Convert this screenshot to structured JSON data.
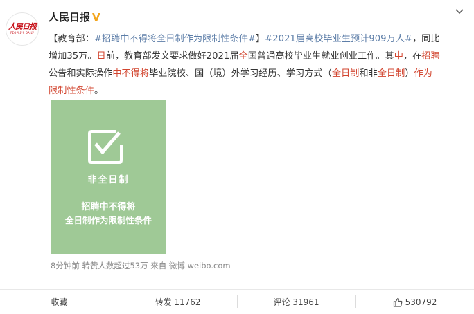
{
  "author": {
    "name": "人民日报",
    "avatar_cn": "人民日报",
    "avatar_en": "PEOPLE'S DAILY",
    "verified_mark": "V",
    "more_icon": "chevron-down-icon"
  },
  "post": {
    "lines": [
      [
        {
          "t": "【教育部：",
          "c": "normal"
        },
        {
          "t": "#招聘中不得将全日制作为限制性条件#",
          "c": "link"
        },
        {
          "t": "】",
          "c": "normal"
        },
        {
          "t": "#2021届高校毕业生预计909万人#",
          "c": "link"
        },
        {
          "t": "，同比",
          "c": "normal"
        }
      ],
      [
        {
          "t": "增加35万。",
          "c": "normal"
        },
        {
          "t": "日",
          "c": "red"
        },
        {
          "t": "前，教育部发文要求做好2021届",
          "c": "normal"
        },
        {
          "t": "全",
          "c": "red"
        },
        {
          "t": "国普通高校毕业生就业创业工作。其",
          "c": "normal"
        },
        {
          "t": "中",
          "c": "red"
        },
        {
          "t": "，在",
          "c": "normal"
        },
        {
          "t": "招聘",
          "c": "red"
        }
      ],
      [
        {
          "t": "公告和实际操作",
          "c": "normal"
        },
        {
          "t": "中不得将",
          "c": "red"
        },
        {
          "t": "毕业院校、国（境）外学习经历、学习方式（",
          "c": "normal"
        },
        {
          "t": "全日制",
          "c": "red"
        },
        {
          "t": "和非",
          "c": "normal"
        },
        {
          "t": "全日制",
          "c": "red"
        },
        {
          "t": "）",
          "c": "normal"
        },
        {
          "t": "作为",
          "c": "red"
        }
      ],
      [
        {
          "t": "限制性条件",
          "c": "red"
        },
        {
          "t": "。",
          "c": "normal"
        }
      ]
    ],
    "image": {
      "label": "非全日制",
      "line1": "招聘中不得将",
      "line2": "全日制作为限制性条件",
      "icon": "checkbox-icon"
    },
    "meta": "8分钟前 转赞人数超过53万 来自 微博 weibo.com"
  },
  "actions": {
    "favorite": "收藏",
    "repost": "转发 11762",
    "comment": "评论 31961",
    "like_count": "530792",
    "like_icon": "thumbs-up-icon",
    "repost_icon": "repost-icon",
    "comment_icon": "comment-icon"
  },
  "colors": {
    "link": "#5d7ea8",
    "highlight": "#d2452f",
    "image_bg": "#9fc996",
    "verified": "#f3a51c"
  }
}
